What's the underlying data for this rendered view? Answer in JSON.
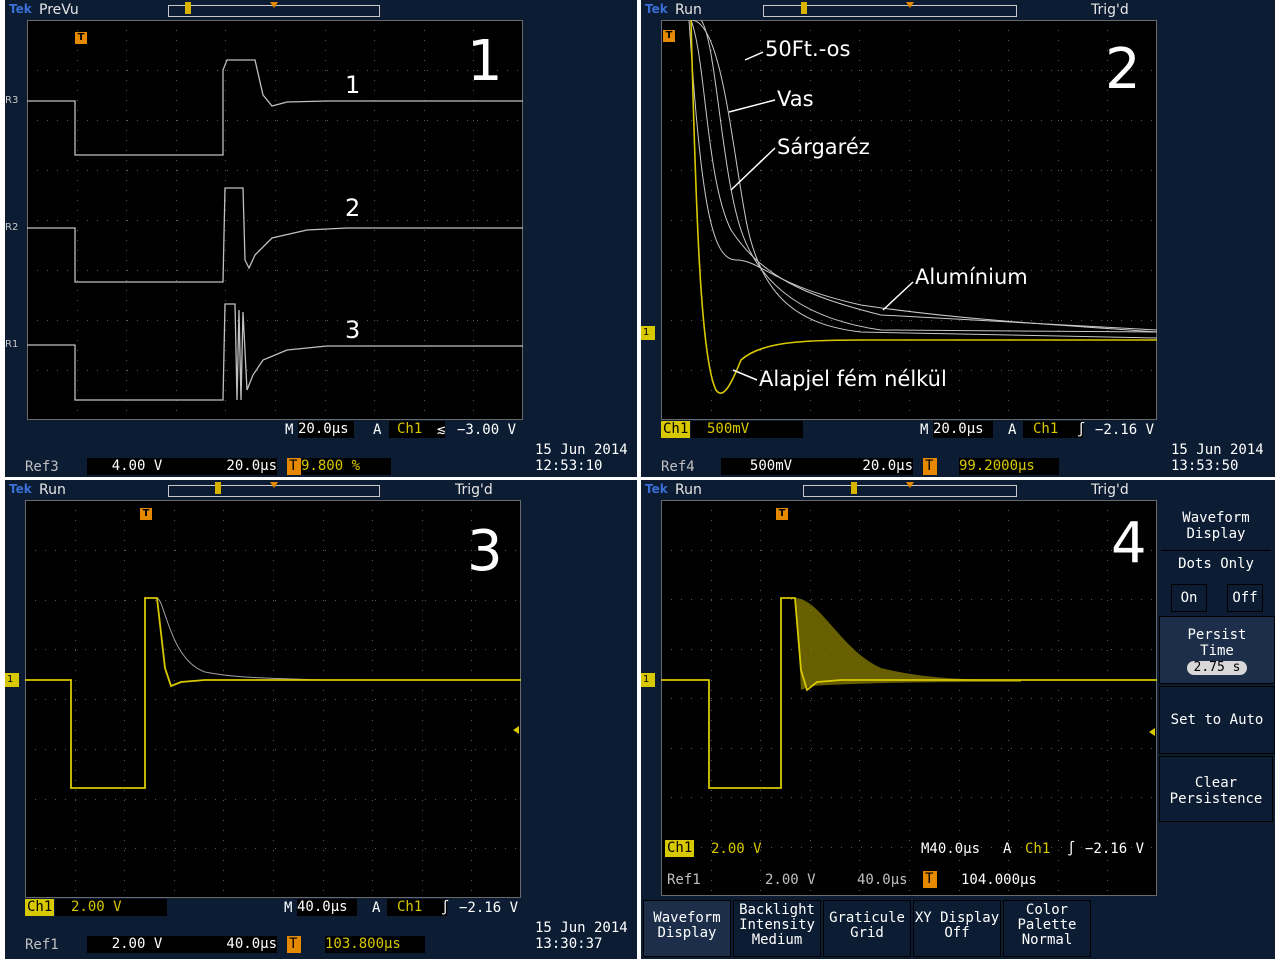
{
  "colors": {
    "bezel": "#0c1c33",
    "screen": "#000000",
    "ch1_yellow": "#d8c800",
    "ref_gray": "#c0c0c0",
    "trigger_orange": "#e58a00"
  },
  "screens": [
    {
      "state": "PreVu",
      "trig_status": "",
      "panel_number": "1",
      "level_markers": [
        "R3",
        "R2",
        "R1"
      ],
      "waveform_labels": [
        "1",
        "2",
        "3"
      ],
      "ch_scale": "",
      "timebase": "20.0µs",
      "trigger_source": "Ch1",
      "trigger_slope": "≲",
      "trigger_level": "−3.00 V",
      "ref_name": "Ref3",
      "ref_volts": "4.00 V",
      "ref_time": "20.0µs",
      "ref_pos": "9.800 %",
      "date": "15 Jun  2014",
      "time": "12:53:10"
    },
    {
      "state": "Run",
      "trig_status": "Trig'd",
      "panel_number": "2",
      "level_markers": [
        "1"
      ],
      "annotations": [
        "50Ft.-os",
        "Vas",
        "Sárgaréz",
        "Alumínium",
        "Alapjel fém nélkül"
      ],
      "ch_name": "Ch1",
      "ch_scale": "500mV",
      "timebase": "20.0µs",
      "trigger_source": "Ch1",
      "trigger_slope": "∫",
      "trigger_level": "−2.16 V",
      "ref_name": "Ref4",
      "ref_volts": "500mV",
      "ref_time": "20.0µs",
      "ref_pos": "99.2000µs",
      "date": "15 Jun  2014",
      "time": "13:53:50"
    },
    {
      "state": "Run",
      "trig_status": "Trig'd",
      "panel_number": "3",
      "level_markers": [
        "1"
      ],
      "ch_name": "Ch1",
      "ch_scale": "2.00 V",
      "timebase": "40.0µs",
      "trigger_source": "Ch1",
      "trigger_slope": "∫",
      "trigger_level": "−2.16 V",
      "ref_name": "Ref1",
      "ref_volts": "2.00 V",
      "ref_time": "40.0µs",
      "ref_pos": "103.800µs",
      "date": "15 Jun  2014",
      "time": "13:30:37"
    },
    {
      "state": "Run",
      "trig_status": "Trig'd",
      "panel_number": "4",
      "level_markers": [
        "1"
      ],
      "ch_name": "Ch1",
      "ch_scale": "2.00 V",
      "timebase": "M40.0µs",
      "trigger_source": "Ch1",
      "trigger_slope": "∫",
      "trigger_level": "−2.16 V",
      "ref_name": "Ref1",
      "ref_volts": "2.00 V",
      "ref_time": "40.0µs",
      "ref_pos": "104.000µs"
    }
  ],
  "timebase_prefix": "M",
  "trigger_prefix": "A",
  "side_menu": {
    "title": "Waveform Display",
    "dots_only": "Dots Only",
    "on": "On",
    "off": "Off",
    "persist_time": "Persist Time",
    "persist_value": "2.75 s",
    "set_to_auto": "Set to Auto",
    "clear_persistence": "Clear Persistence"
  },
  "bottom_menu": [
    {
      "line1": "Waveform",
      "line2": "Display",
      "line3": ""
    },
    {
      "line1": "Backlight",
      "line2": "Intensity",
      "line3": "Medium"
    },
    {
      "line1": "Graticule",
      "line2": "Grid",
      "line3": ""
    },
    {
      "line1": "XY Display",
      "line2": "Off",
      "line3": ""
    },
    {
      "line1": "Color",
      "line2": "Palette",
      "line3": "Normal"
    }
  ]
}
